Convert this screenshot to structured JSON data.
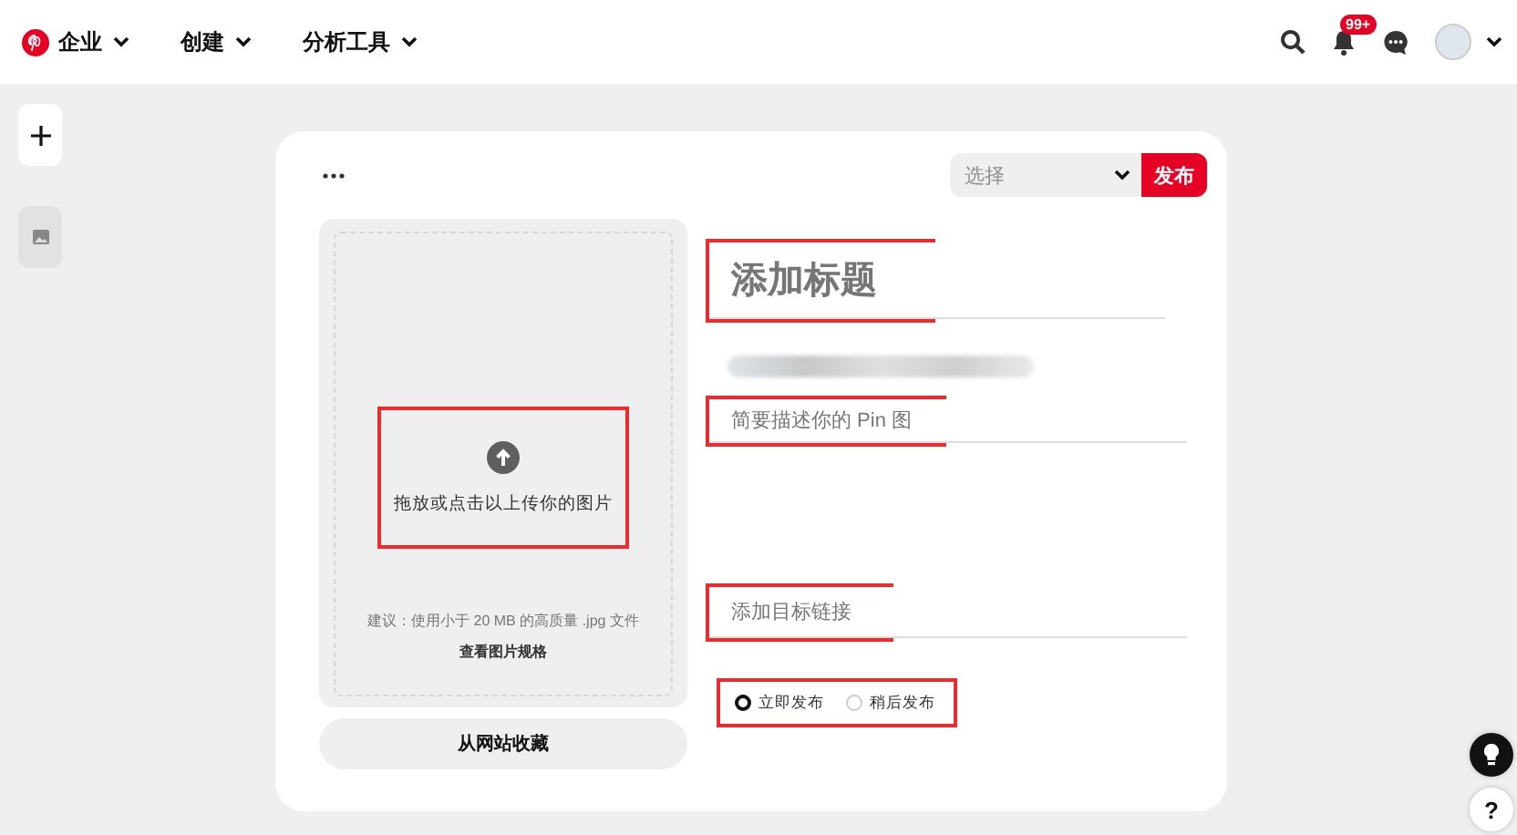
{
  "nav": {
    "items": [
      {
        "label": "企业"
      },
      {
        "label": "创建"
      },
      {
        "label": "分析工具"
      }
    ],
    "notification_badge": "99+"
  },
  "sidebar": {
    "items": [
      {
        "kind": "add"
      },
      {
        "kind": "image"
      }
    ]
  },
  "editor": {
    "board_select": {
      "placeholder": "选择"
    },
    "publish_button": "发布",
    "upload": {
      "prompt": "拖放或点击以上传你的图片",
      "annotated": true,
      "hint": "建议：使用小于 20 MB 的高质量 .jpg 文件",
      "spec_link": "查看图片规格"
    },
    "save_from_site_button": "从网站收藏",
    "title": {
      "placeholder": "添加标题",
      "annotated": true
    },
    "description": {
      "placeholder": "简要描述你的 Pin 图",
      "annotated": true
    },
    "link": {
      "placeholder": "添加目标链接",
      "annotated": true
    },
    "publish_timing": {
      "annotated": true,
      "options": [
        {
          "label": "立即发布",
          "selected": true
        },
        {
          "label": "稍后发布",
          "selected": false
        }
      ]
    }
  },
  "help_button": "?"
}
